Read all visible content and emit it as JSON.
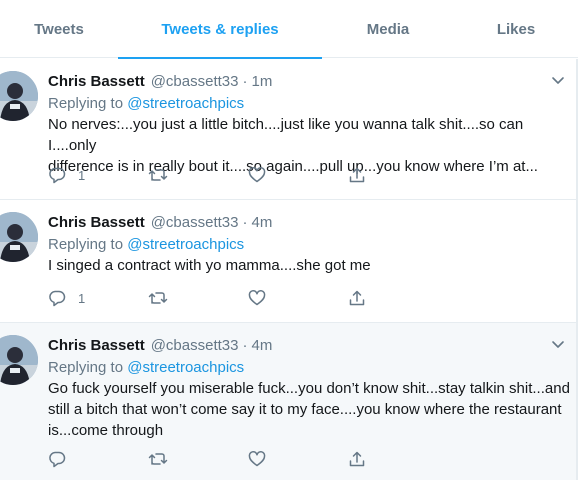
{
  "tabs": [
    {
      "label": "Tweets",
      "active": false
    },
    {
      "label": "Tweets & replies",
      "active": true
    },
    {
      "label": "Media",
      "active": false
    },
    {
      "label": "Likes",
      "active": false
    }
  ],
  "colors": {
    "accent": "#1da1f2",
    "muted": "#657786",
    "text": "#14171a",
    "mention": "#1b95e0",
    "hover_bg": "#f5f8fa"
  },
  "tweets": [
    {
      "name": "Chris Bassett",
      "handle": "@cbassett33",
      "separator": "·",
      "time": "1m",
      "replying_prefix": "Replying to",
      "replying_to": "@streetroachpics",
      "lines": [
        "No nerves:...you just a little bitch....just like you wanna talk shit....so can I....only",
        "difference is in really bout it....so again....pull up...you know where I’m at..."
      ],
      "reply_count": "1",
      "icons": [
        "reply-icon",
        "retweet-icon",
        "like-icon",
        "share-icon",
        "chevron-down-icon"
      ]
    },
    {
      "name": "Chris Bassett",
      "handle": "@cbassett33",
      "separator": "·",
      "time": "4m",
      "replying_prefix": "Replying to",
      "replying_to": "@streetroachpics",
      "lines": [
        "I singed a contract with yo mamma....she got me"
      ],
      "reply_count": "1",
      "icons": [
        "reply-icon",
        "retweet-icon",
        "like-icon",
        "share-icon",
        "chevron-down-icon"
      ]
    },
    {
      "name": "Chris Bassett",
      "handle": "@cbassett33",
      "separator": "·",
      "time": "4m",
      "replying_prefix": "Replying to",
      "replying_to": "@streetroachpics",
      "lines": [
        "Go fuck yourself you miserable fuck...you don’t know shit...stay talkin shit...and",
        "still a bitch that won’t come say it to my face....you know where the restaurant",
        "is...come through"
      ],
      "reply_count": "",
      "icons": [
        "reply-icon",
        "retweet-icon",
        "like-icon",
        "share-icon",
        "chevron-down-icon"
      ]
    }
  ]
}
